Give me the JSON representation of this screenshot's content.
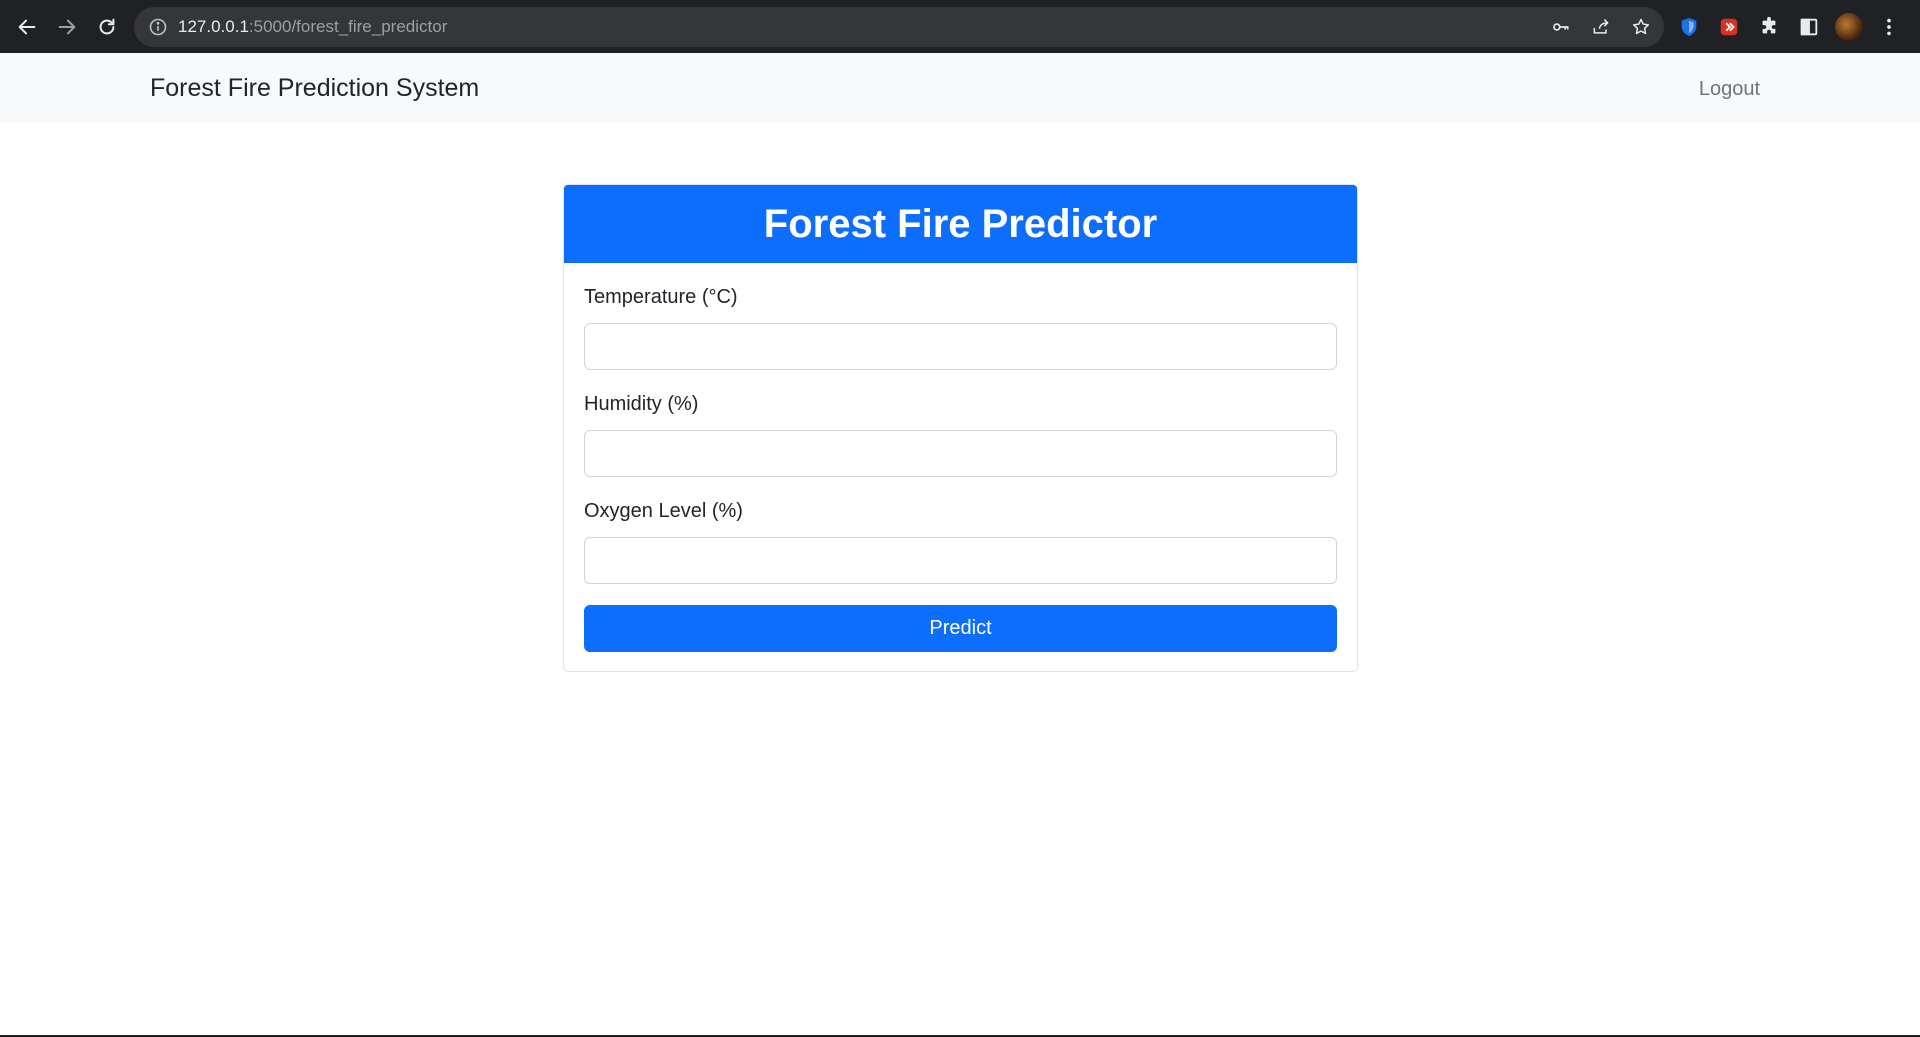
{
  "browser": {
    "url_host": "127.0.0.1",
    "url_path": ":5000/forest_fire_predictor",
    "icons": [
      "back-arrow-icon",
      "forward-arrow-icon",
      "reload-icon",
      "info-icon",
      "key-icon",
      "share-icon",
      "star-icon",
      "shield-extension-icon",
      "red-extension-icon",
      "puzzle-icon",
      "side-panel-icon",
      "kebab-menu-icon"
    ]
  },
  "navbar": {
    "brand": "Forest Fire Prediction System",
    "logout": "Logout"
  },
  "form": {
    "title": "Forest Fire Predictor",
    "temperature_label": "Temperature (°C)",
    "temperature_value": "",
    "humidity_label": "Humidity (%)",
    "humidity_value": "",
    "oxygen_label": "Oxygen Level (%)",
    "oxygen_value": "",
    "submit_label": "Predict"
  },
  "colors": {
    "primary": "#0d6efd",
    "navbar_bg": "#f8f9fa",
    "chrome_bg": "#202124"
  }
}
